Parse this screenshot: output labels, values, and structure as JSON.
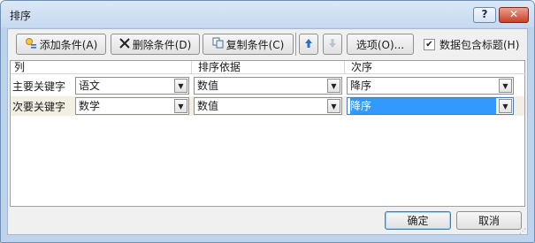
{
  "window": {
    "title": "排序",
    "help_label": "?",
    "close_label": "✕"
  },
  "toolbar": {
    "add_label": "添加条件(A)",
    "delete_label": "删除条件(D)",
    "copy_label": "复制条件(C)",
    "move_up_label": "⇧",
    "move_down_label": "⇩",
    "options_label": "选项(O)...",
    "header_checkbox_label": "数据包含标题(H)",
    "header_checkbox_checked": true
  },
  "grid": {
    "headers": {
      "column": "列",
      "sort_on": "排序依据",
      "order": "次序"
    },
    "rows": [
      {
        "label": "主要关键字",
        "column": "语文",
        "sort_on": "数值",
        "order": "降序"
      },
      {
        "label": "次要关键字",
        "column": "数学",
        "sort_on": "数值",
        "order": "降序"
      }
    ]
  },
  "footer": {
    "ok_label": "确定",
    "cancel_label": "取消"
  },
  "icons": {
    "add": "add-level-icon",
    "delete": "delete-x-icon",
    "copy": "copy-icon",
    "up": "arrow-up-icon",
    "down": "arrow-down-icon",
    "dropdown": "chevron-down-icon",
    "check": "checkmark-icon"
  }
}
